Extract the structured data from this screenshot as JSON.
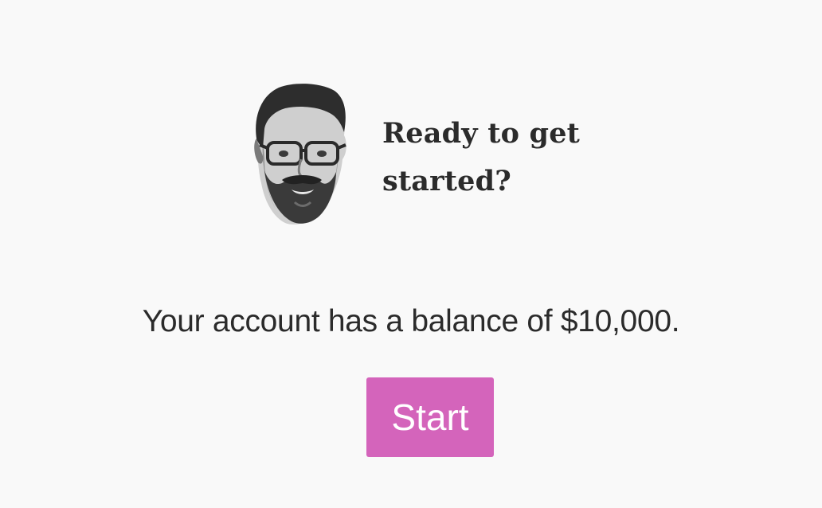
{
  "hero": {
    "avatar_icon": "bearded-man-with-glasses-portrait",
    "prompt": "Ready to get started?"
  },
  "account": {
    "balance_message": "Your account has a balance of $10,000."
  },
  "actions": {
    "start_label": "Start"
  },
  "colors": {
    "background": "#f9f9f9",
    "text": "#2b2b2b",
    "accent": "#d464bb"
  }
}
